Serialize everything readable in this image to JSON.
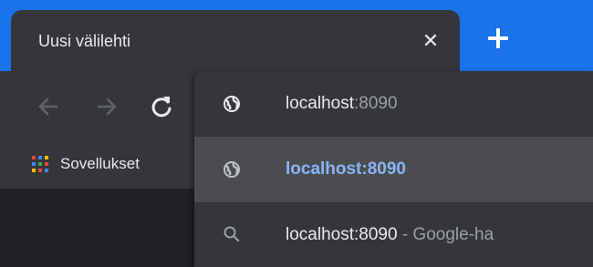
{
  "tab": {
    "title": "Uusi välilehti",
    "close_icon": "close-icon",
    "new_tab_icon": "plus-icon"
  },
  "colors": {
    "tabstrip": "#1a73e8",
    "tab": "#35363a",
    "content": "#202124",
    "selected_row": "#4b4c50",
    "link": "#8ab4f8"
  },
  "toolbar": {
    "back_icon": "arrow-left-icon",
    "forward_icon": "arrow-right-icon",
    "reload_icon": "reload-icon"
  },
  "bookmarks": {
    "apps_icon": "apps-grid-icon",
    "apps_label": "Sovellukset"
  },
  "omnibox_dropdown": {
    "rows": [
      {
        "icon": "globe-icon",
        "typed": "localhost",
        "autocomplete": ":8090"
      },
      {
        "icon": "globe-icon",
        "text": "localhost:8090",
        "selected": true
      },
      {
        "icon": "search-icon",
        "query": "localhost:8090",
        "suffix": " - Google-ha"
      }
    ]
  }
}
